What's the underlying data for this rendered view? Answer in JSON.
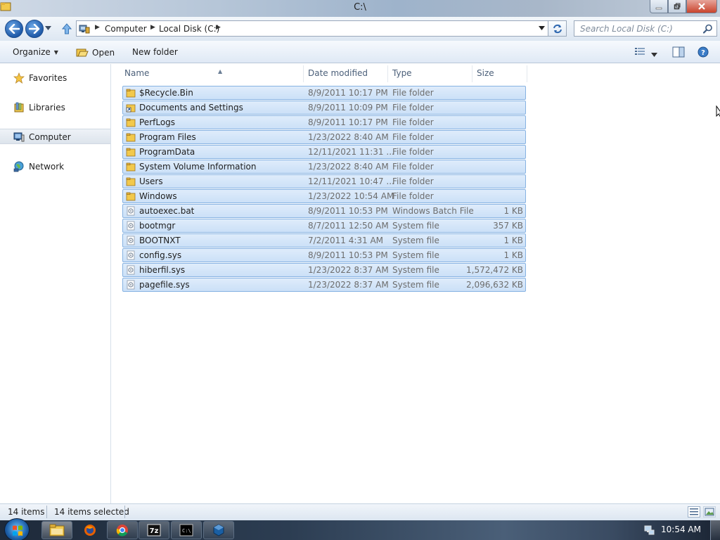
{
  "window": {
    "title": "C:\\"
  },
  "address_bar": {
    "crumbs": [
      "Computer",
      "Local Disk (C:)"
    ]
  },
  "search": {
    "placeholder": "Search Local Disk (C:)"
  },
  "toolbar": {
    "organize_label": "Organize",
    "open_label": "Open",
    "new_folder_label": "New folder"
  },
  "nav_pane": {
    "items": [
      {
        "label": "Favorites",
        "icon": "star-icon"
      },
      {
        "label": "Libraries",
        "icon": "libraries-icon"
      },
      {
        "label": "Computer",
        "icon": "computer-icon",
        "selected": true
      },
      {
        "label": "Network",
        "icon": "network-icon"
      }
    ]
  },
  "columns": {
    "name": "Name",
    "date": "Date modified",
    "type": "Type",
    "size": "Size"
  },
  "files": [
    {
      "name": "$Recycle.Bin",
      "date": "8/9/2011 10:17 PM",
      "type": "File folder",
      "size": "",
      "icon": "folder-icon"
    },
    {
      "name": "Documents and Settings",
      "date": "8/9/2011 10:09 PM",
      "type": "File folder",
      "size": "",
      "icon": "shortcut-folder-icon"
    },
    {
      "name": "PerfLogs",
      "date": "8/9/2011 10:17 PM",
      "type": "File folder",
      "size": "",
      "icon": "folder-icon"
    },
    {
      "name": "Program Files",
      "date": "1/23/2022 8:40 AM",
      "type": "File folder",
      "size": "",
      "icon": "folder-icon"
    },
    {
      "name": "ProgramData",
      "date": "12/11/2021 11:31 ...",
      "type": "File folder",
      "size": "",
      "icon": "folder-icon"
    },
    {
      "name": "System Volume Information",
      "date": "1/23/2022 8:40 AM",
      "type": "File folder",
      "size": "",
      "icon": "folder-icon"
    },
    {
      "name": "Users",
      "date": "12/11/2021 10:47 ...",
      "type": "File folder",
      "size": "",
      "icon": "folder-icon"
    },
    {
      "name": "Windows",
      "date": "1/23/2022 10:54 AM",
      "type": "File folder",
      "size": "",
      "icon": "folder-icon"
    },
    {
      "name": "autoexec.bat",
      "date": "8/9/2011 10:53 PM",
      "type": "Windows Batch File",
      "size": "1 KB",
      "icon": "batch-file-icon"
    },
    {
      "name": "bootmgr",
      "date": "8/7/2011 12:50 AM",
      "type": "System file",
      "size": "357 KB",
      "icon": "system-file-icon"
    },
    {
      "name": "BOOTNXT",
      "date": "7/2/2011 4:31 AM",
      "type": "System file",
      "size": "1 KB",
      "icon": "system-file-icon"
    },
    {
      "name": "config.sys",
      "date": "8/9/2011 10:53 PM",
      "type": "System file",
      "size": "1 KB",
      "icon": "system-file-icon"
    },
    {
      "name": "hiberfil.sys",
      "date": "1/23/2022 8:37 AM",
      "type": "System file",
      "size": "1,572,472 KB",
      "icon": "system-file-icon"
    },
    {
      "name": "pagefile.sys",
      "date": "1/23/2022 8:37 AM",
      "type": "System file",
      "size": "2,096,632 KB",
      "icon": "system-file-icon"
    }
  ],
  "status": {
    "item_count": "14 items",
    "selected_count": "14 items selected"
  },
  "taskbar": {
    "clock": "10:54 AM",
    "pinned": [
      "explorer-icon",
      "firefox-icon",
      "chrome-icon",
      "7zip-icon",
      "cmd-icon",
      "virtualbox-icon"
    ]
  },
  "colors": {
    "selection_fill": "#cbe0f7",
    "selection_border": "#86b2e2",
    "folder_yellow": "#f2c94c"
  }
}
